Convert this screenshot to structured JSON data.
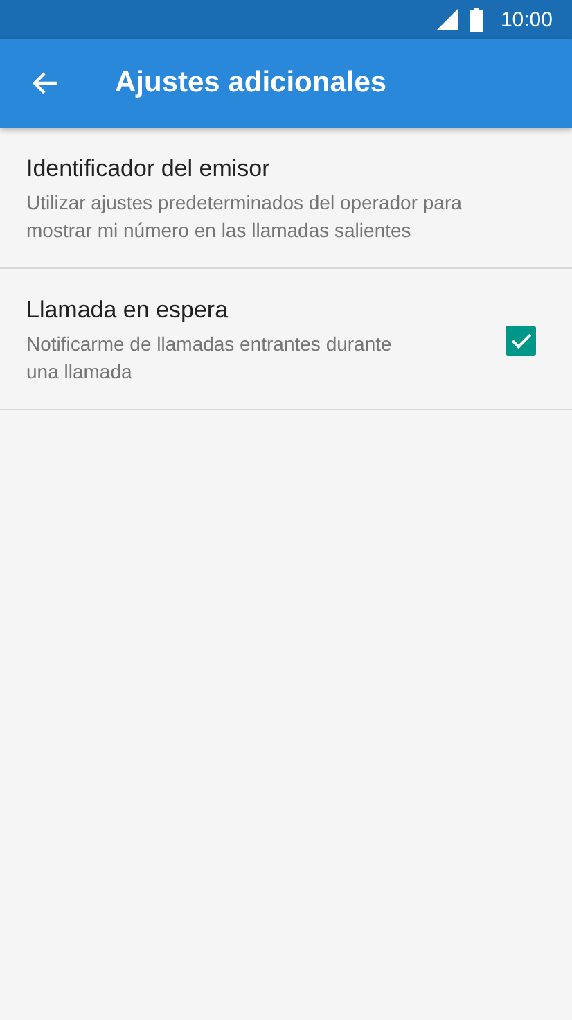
{
  "status_bar": {
    "time": "10:00"
  },
  "app_bar": {
    "title": "Ajustes adicionales"
  },
  "settings": [
    {
      "kind": "plain",
      "title": "Identificador del emisor",
      "summary": "Utilizar ajustes predeterminados del operador para mostrar mi número en las llamadas salientes"
    },
    {
      "kind": "checkbox",
      "title": "Llamada en espera",
      "summary": "Notificarme de llamadas entrantes durante una llamada",
      "checked": true
    }
  ]
}
